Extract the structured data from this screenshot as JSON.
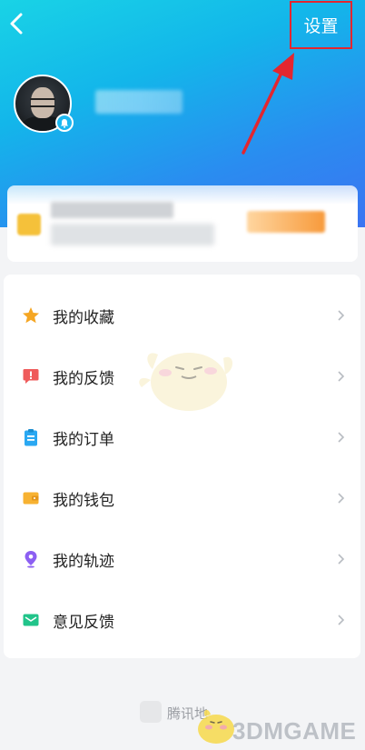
{
  "header": {
    "back_icon": "chevron-left-icon",
    "settings_label": "设置",
    "colors": {
      "gradient_start": "#19d3e6",
      "gradient_end": "#3b74f2",
      "highlight": "#e3262f"
    }
  },
  "menu": {
    "items": [
      {
        "label": "我的收藏",
        "icon": "star-icon",
        "color": "#f5a623"
      },
      {
        "label": "我的反馈",
        "icon": "alert-bubble-icon",
        "color": "#ef5b5b"
      },
      {
        "label": "我的订单",
        "icon": "clipboard-icon",
        "color": "#2aa8f2"
      },
      {
        "label": "我的钱包",
        "icon": "wallet-icon",
        "color": "#f7b232"
      },
      {
        "label": "我的轨迹",
        "icon": "location-pin-icon",
        "color": "#8c5ff2"
      },
      {
        "label": "意见反馈",
        "icon": "mail-icon",
        "color": "#21c48a"
      }
    ]
  },
  "footer": {
    "logo_icon": "compass-icon",
    "text": "腾讯地"
  },
  "watermark": {
    "text": "3DMGAME"
  }
}
